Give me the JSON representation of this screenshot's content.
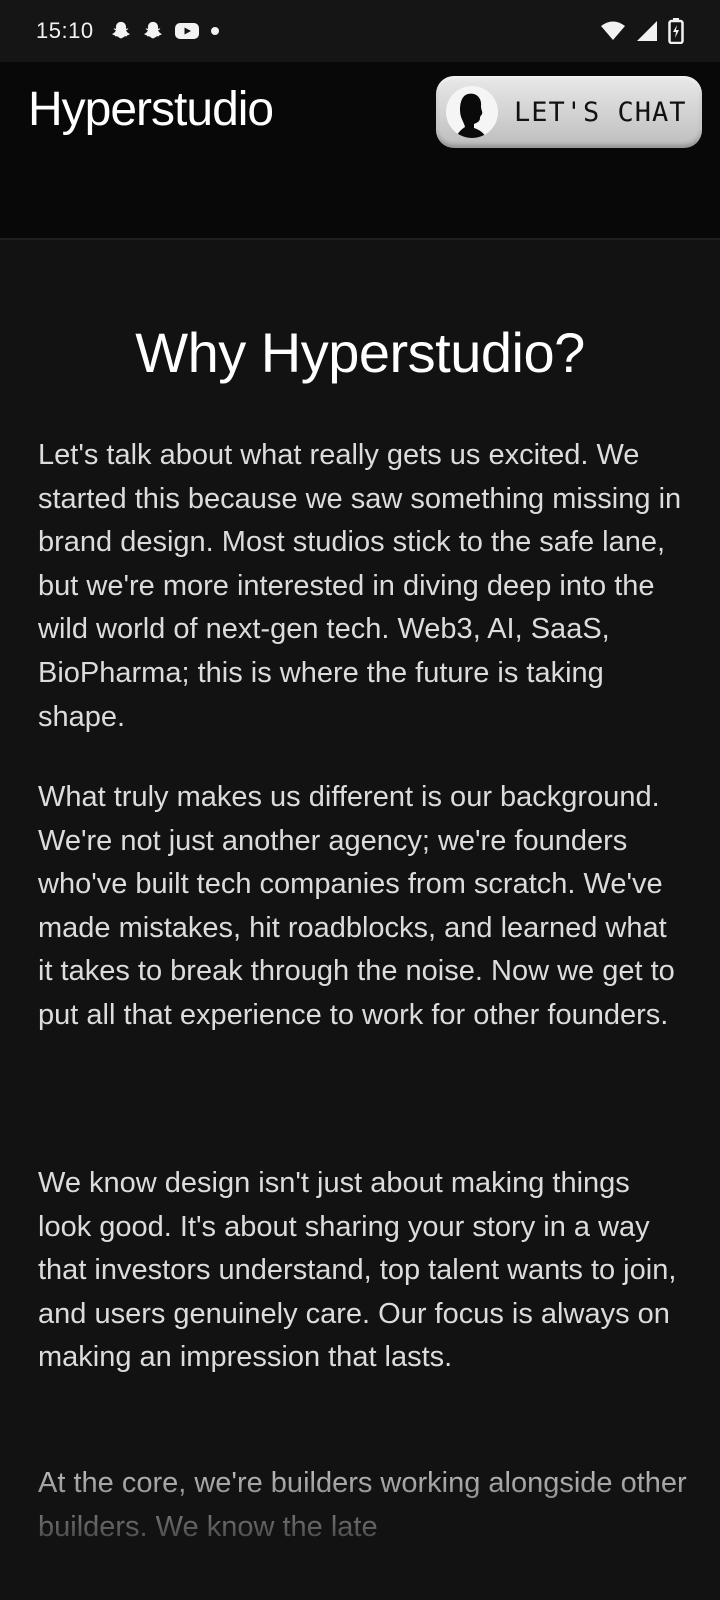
{
  "status_bar": {
    "time": "15:10",
    "icons_left": [
      "snapchat-icon",
      "snapchat-icon",
      "youtube-icon",
      "dot-icon"
    ],
    "icons_right": [
      "wifi-icon",
      "signal-icon",
      "battery-charging-icon"
    ]
  },
  "header": {
    "brand": "Hyperstudio",
    "chat_button_label": "LET'S CHAT"
  },
  "main": {
    "title": "Why Hyperstudio?",
    "paragraphs": [
      "Let's talk about what really gets us excited. We started this because we saw something missing in brand design. Most studios stick to the safe lane, but we're more interested in diving deep into the wild world of next-gen tech. Web3, AI, SaaS, BioPharma; this is where the future is taking shape.",
      "What truly makes us different is our background. We're not just another agency; we're founders who've built tech companies from scratch. We've made mistakes, hit roadblocks, and learned what it takes to break through the noise. Now we get to put all that experience to work for other founders.",
      "We know design isn't just about making things look good. It's about sharing your story in a way that investors understand, top talent wants to join, and users genuinely care. Our focus is always on making an impression that lasts.",
      "At the core, we're builders working alongside other builders. We know the late"
    ]
  },
  "colors": {
    "background": "#121212",
    "header_bg": "#080808",
    "button_bg": "#d9d9d9",
    "text": "#dcdcdc"
  }
}
